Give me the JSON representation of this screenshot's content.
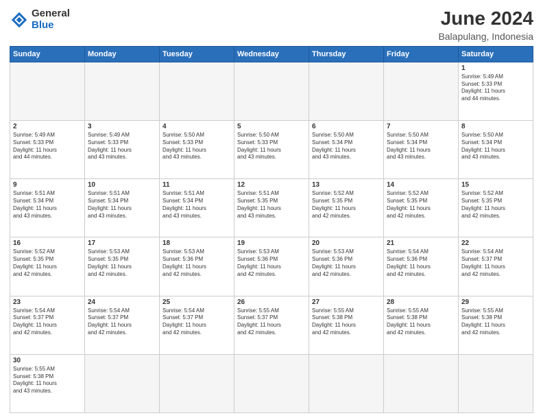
{
  "logo": {
    "text_general": "General",
    "text_blue": "Blue"
  },
  "header": {
    "title": "June 2024",
    "subtitle": "Balapulang, Indonesia"
  },
  "weekdays": [
    "Sunday",
    "Monday",
    "Tuesday",
    "Wednesday",
    "Thursday",
    "Friday",
    "Saturday"
  ],
  "weeks": [
    [
      {
        "day": "",
        "info": ""
      },
      {
        "day": "",
        "info": ""
      },
      {
        "day": "",
        "info": ""
      },
      {
        "day": "",
        "info": ""
      },
      {
        "day": "",
        "info": ""
      },
      {
        "day": "",
        "info": ""
      },
      {
        "day": "1",
        "info": "Sunrise: 5:49 AM\nSunset: 5:33 PM\nDaylight: 11 hours\nand 44 minutes."
      }
    ],
    [
      {
        "day": "2",
        "info": "Sunrise: 5:49 AM\nSunset: 5:33 PM\nDaylight: 11 hours\nand 44 minutes."
      },
      {
        "day": "3",
        "info": "Sunrise: 5:49 AM\nSunset: 5:33 PM\nDaylight: 11 hours\nand 43 minutes."
      },
      {
        "day": "4",
        "info": "Sunrise: 5:50 AM\nSunset: 5:33 PM\nDaylight: 11 hours\nand 43 minutes."
      },
      {
        "day": "5",
        "info": "Sunrise: 5:50 AM\nSunset: 5:33 PM\nDaylight: 11 hours\nand 43 minutes."
      },
      {
        "day": "6",
        "info": "Sunrise: 5:50 AM\nSunset: 5:34 PM\nDaylight: 11 hours\nand 43 minutes."
      },
      {
        "day": "7",
        "info": "Sunrise: 5:50 AM\nSunset: 5:34 PM\nDaylight: 11 hours\nand 43 minutes."
      },
      {
        "day": "8",
        "info": "Sunrise: 5:50 AM\nSunset: 5:34 PM\nDaylight: 11 hours\nand 43 minutes."
      }
    ],
    [
      {
        "day": "9",
        "info": "Sunrise: 5:51 AM\nSunset: 5:34 PM\nDaylight: 11 hours\nand 43 minutes."
      },
      {
        "day": "10",
        "info": "Sunrise: 5:51 AM\nSunset: 5:34 PM\nDaylight: 11 hours\nand 43 minutes."
      },
      {
        "day": "11",
        "info": "Sunrise: 5:51 AM\nSunset: 5:34 PM\nDaylight: 11 hours\nand 43 minutes."
      },
      {
        "day": "12",
        "info": "Sunrise: 5:51 AM\nSunset: 5:35 PM\nDaylight: 11 hours\nand 43 minutes."
      },
      {
        "day": "13",
        "info": "Sunrise: 5:52 AM\nSunset: 5:35 PM\nDaylight: 11 hours\nand 42 minutes."
      },
      {
        "day": "14",
        "info": "Sunrise: 5:52 AM\nSunset: 5:35 PM\nDaylight: 11 hours\nand 42 minutes."
      },
      {
        "day": "15",
        "info": "Sunrise: 5:52 AM\nSunset: 5:35 PM\nDaylight: 11 hours\nand 42 minutes."
      }
    ],
    [
      {
        "day": "16",
        "info": "Sunrise: 5:52 AM\nSunset: 5:35 PM\nDaylight: 11 hours\nand 42 minutes."
      },
      {
        "day": "17",
        "info": "Sunrise: 5:53 AM\nSunset: 5:35 PM\nDaylight: 11 hours\nand 42 minutes."
      },
      {
        "day": "18",
        "info": "Sunrise: 5:53 AM\nSunset: 5:36 PM\nDaylight: 11 hours\nand 42 minutes."
      },
      {
        "day": "19",
        "info": "Sunrise: 5:53 AM\nSunset: 5:36 PM\nDaylight: 11 hours\nand 42 minutes."
      },
      {
        "day": "20",
        "info": "Sunrise: 5:53 AM\nSunset: 5:36 PM\nDaylight: 11 hours\nand 42 minutes."
      },
      {
        "day": "21",
        "info": "Sunrise: 5:54 AM\nSunset: 5:36 PM\nDaylight: 11 hours\nand 42 minutes."
      },
      {
        "day": "22",
        "info": "Sunrise: 5:54 AM\nSunset: 5:37 PM\nDaylight: 11 hours\nand 42 minutes."
      }
    ],
    [
      {
        "day": "23",
        "info": "Sunrise: 5:54 AM\nSunset: 5:37 PM\nDaylight: 11 hours\nand 42 minutes."
      },
      {
        "day": "24",
        "info": "Sunrise: 5:54 AM\nSunset: 5:37 PM\nDaylight: 11 hours\nand 42 minutes."
      },
      {
        "day": "25",
        "info": "Sunrise: 5:54 AM\nSunset: 5:37 PM\nDaylight: 11 hours\nand 42 minutes."
      },
      {
        "day": "26",
        "info": "Sunrise: 5:55 AM\nSunset: 5:37 PM\nDaylight: 11 hours\nand 42 minutes."
      },
      {
        "day": "27",
        "info": "Sunrise: 5:55 AM\nSunset: 5:38 PM\nDaylight: 11 hours\nand 42 minutes."
      },
      {
        "day": "28",
        "info": "Sunrise: 5:55 AM\nSunset: 5:38 PM\nDaylight: 11 hours\nand 42 minutes."
      },
      {
        "day": "29",
        "info": "Sunrise: 5:55 AM\nSunset: 5:38 PM\nDaylight: 11 hours\nand 42 minutes."
      }
    ],
    [
      {
        "day": "30",
        "info": "Sunrise: 5:55 AM\nSunset: 5:38 PM\nDaylight: 11 hours\nand 43 minutes."
      },
      {
        "day": "",
        "info": ""
      },
      {
        "day": "",
        "info": ""
      },
      {
        "day": "",
        "info": ""
      },
      {
        "day": "",
        "info": ""
      },
      {
        "day": "",
        "info": ""
      },
      {
        "day": "",
        "info": ""
      }
    ]
  ]
}
